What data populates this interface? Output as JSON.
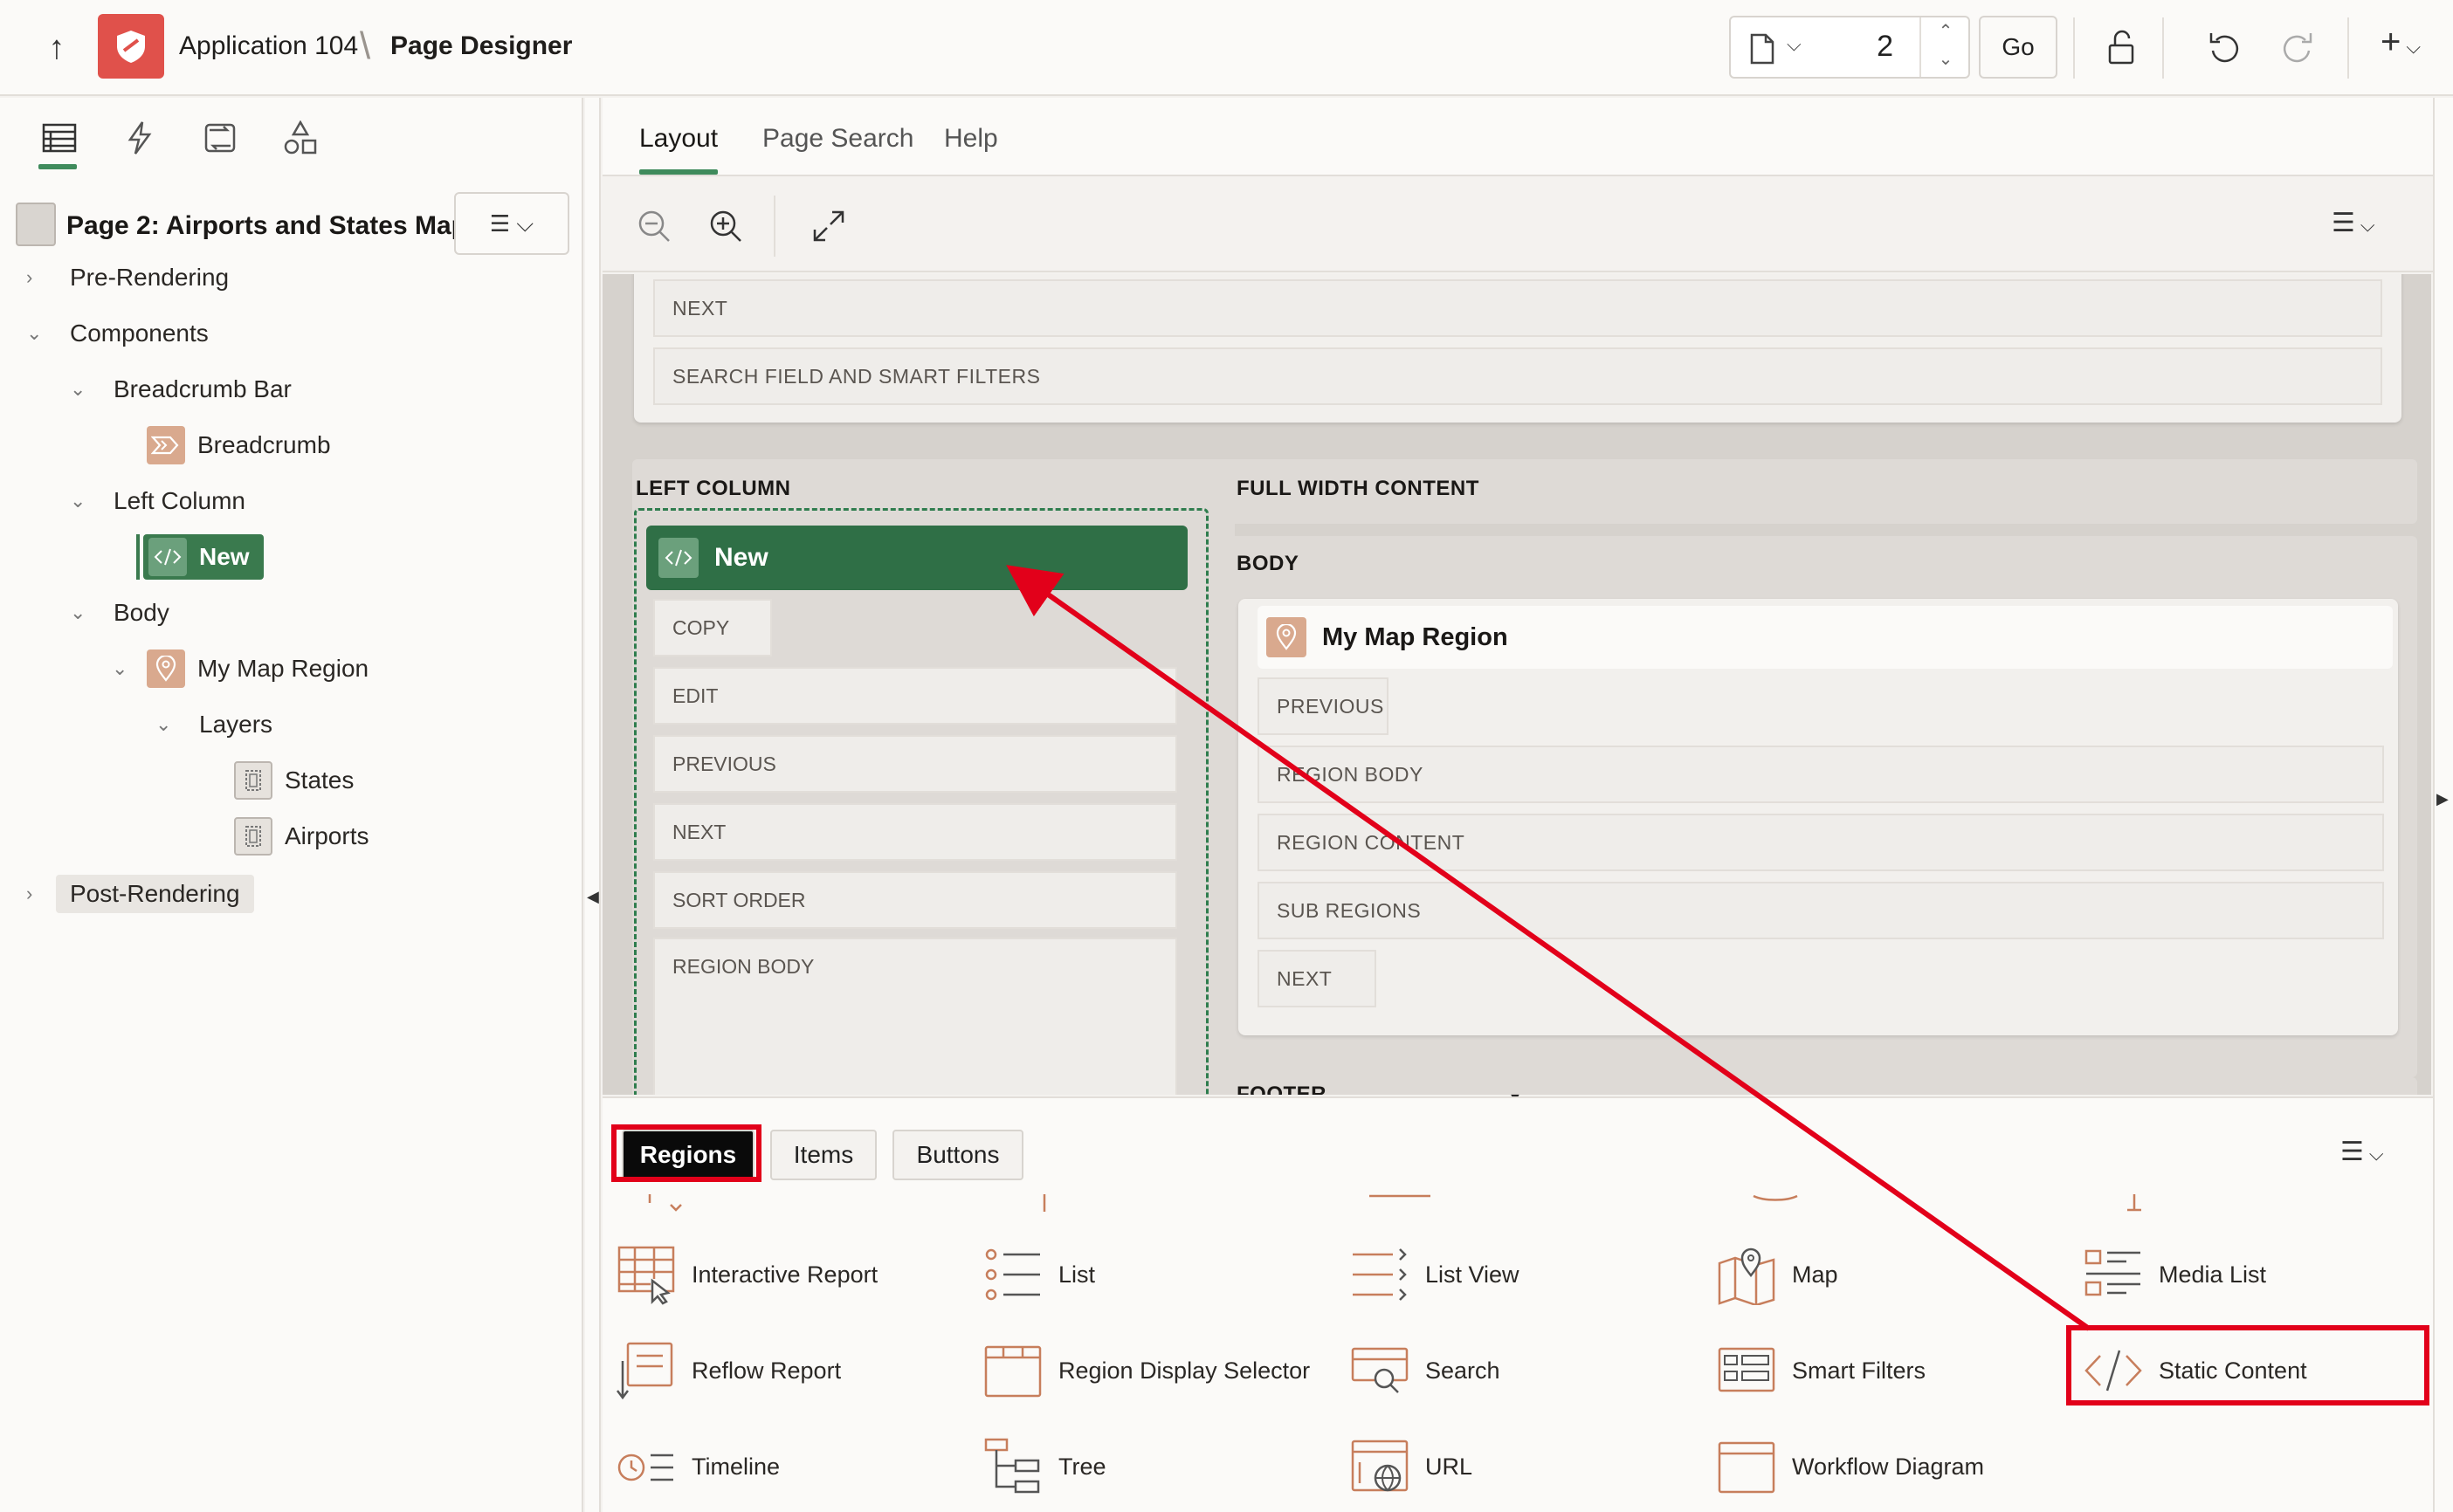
{
  "header": {
    "app_name": "Application 104",
    "page_title": "Page Designer",
    "page_number": "2",
    "go_label": "Go",
    "add_label": "+"
  },
  "left_pane": {
    "page_label": "Page 2: Airports and States Map",
    "tree": {
      "pre_rendering": "Pre-Rendering",
      "components": "Components",
      "breadcrumb_bar": "Breadcrumb Bar",
      "breadcrumb": "Breadcrumb",
      "left_column": "Left Column",
      "new": "New",
      "body": "Body",
      "my_map_region": "My Map Region",
      "layers": "Layers",
      "states": "States",
      "airports": "Airports",
      "post_rendering": "Post-Rendering"
    }
  },
  "center": {
    "tabs": [
      "Layout",
      "Page Search",
      "Help"
    ],
    "canvas": {
      "header_slots": [
        "NEXT",
        "SEARCH FIELD AND SMART FILTERS"
      ],
      "left_column_title": "LEFT COLUMN",
      "new_region_label": "New",
      "new_region_slots": [
        "COPY",
        "EDIT",
        "PREVIOUS",
        "NEXT",
        "SORT ORDER",
        "REGION BODY"
      ],
      "full_width_title": "FULL WIDTH CONTENT",
      "body_title": "BODY",
      "map_region_label": "My Map Region",
      "map_region_slots": [
        "PREVIOUS",
        "REGION BODY",
        "REGION CONTENT",
        "SUB REGIONS",
        "NEXT"
      ],
      "footer_title": "FOOTER"
    }
  },
  "gallery": {
    "tabs": [
      "Regions",
      "Items",
      "Buttons"
    ],
    "items": [
      {
        "label": "Interactive Report",
        "icon": "interactive-report-icon"
      },
      {
        "label": "List",
        "icon": "list-icon"
      },
      {
        "label": "List View",
        "icon": "list-view-icon"
      },
      {
        "label": "Map",
        "icon": "map-icon"
      },
      {
        "label": "Media List",
        "icon": "media-list-icon"
      },
      {
        "label": "Reflow Report",
        "icon": "reflow-report-icon"
      },
      {
        "label": "Region Display Selector",
        "icon": "region-display-selector-icon"
      },
      {
        "label": "Search",
        "icon": "search-icon"
      },
      {
        "label": "Smart Filters",
        "icon": "smart-filters-icon"
      },
      {
        "label": "Static Content",
        "icon": "static-content-icon"
      },
      {
        "label": "Timeline",
        "icon": "timeline-icon"
      },
      {
        "label": "Tree",
        "icon": "tree-icon"
      },
      {
        "label": "URL",
        "icon": "url-icon"
      },
      {
        "label": "Workflow Diagram",
        "icon": "workflow-diagram-icon"
      }
    ]
  },
  "colors": {
    "accent_green": "#3f8b5c",
    "selected_region": "#2f6f46",
    "app_logo": "#e0514b",
    "annotation_red": "#e2001a",
    "icon_orange": "#c77e5c"
  }
}
